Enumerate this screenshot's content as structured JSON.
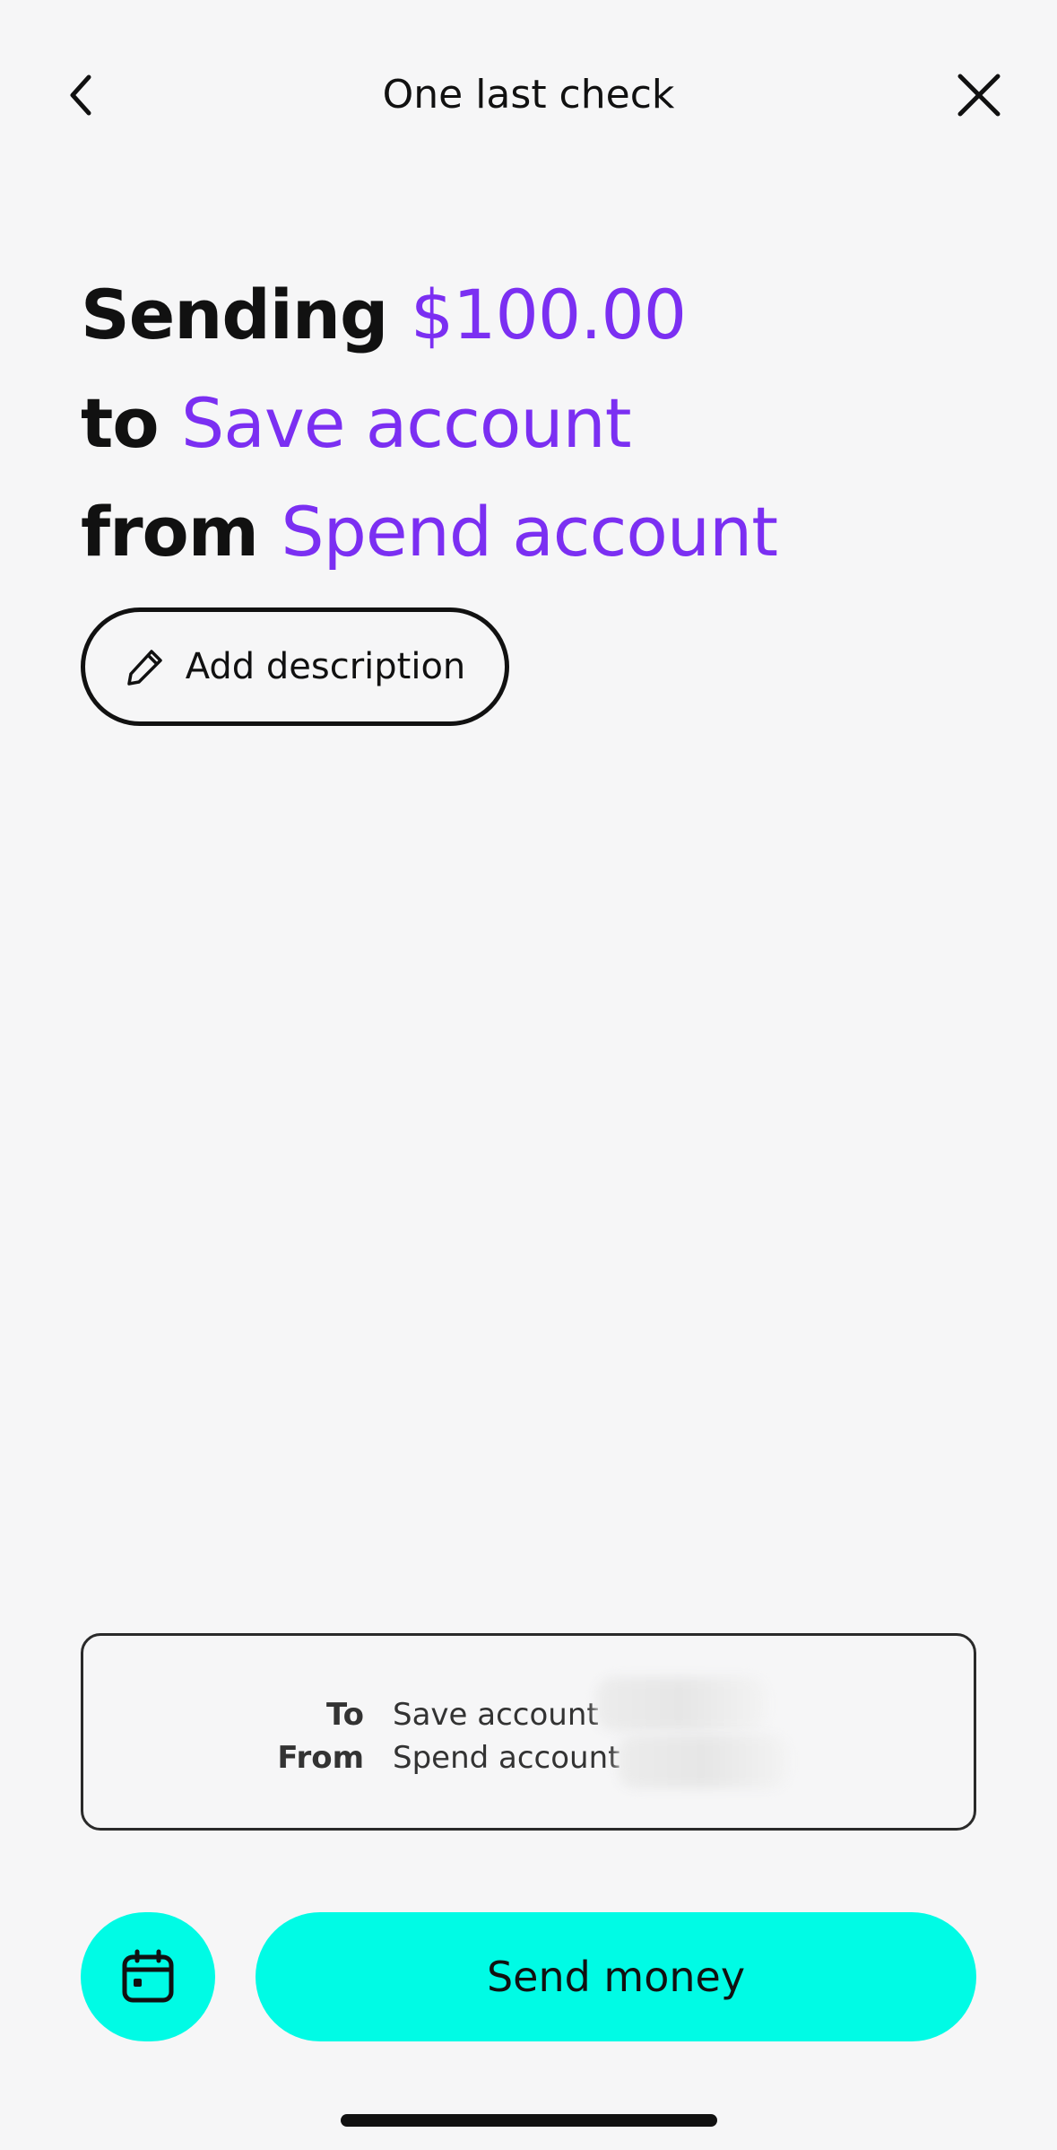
{
  "header": {
    "title": "One last check"
  },
  "headline": {
    "sending_word": "Sending",
    "amount": "$100.00",
    "to_word": "to",
    "to_account": "Save account",
    "from_word": "from",
    "from_account": "Spend account"
  },
  "add_description": {
    "label": "Add description",
    "icon": "pencil-icon"
  },
  "summary": {
    "rows": [
      {
        "key": "To",
        "value": "Save account"
      },
      {
        "key": "From",
        "value": "Spend account"
      }
    ]
  },
  "actions": {
    "schedule_icon": "calendar-icon",
    "send_label": "Send money"
  },
  "colors": {
    "accent": "#7b2ff2",
    "button": "#00fbe5",
    "background": "#f6f6f7"
  }
}
